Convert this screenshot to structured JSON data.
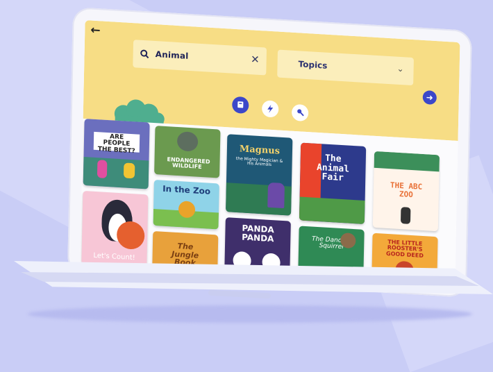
{
  "header": {
    "back_icon": "back-arrow-icon",
    "search": {
      "value": "Animal",
      "icon": "search-icon",
      "clear_icon": "close-icon"
    },
    "topics": {
      "label": "Topics",
      "icon": "chevron-down-icon"
    },
    "go_icon": "arrow-right-icon",
    "filters": [
      {
        "icon": "book-icon",
        "active": true
      },
      {
        "icon": "lightning-icon",
        "active": false
      },
      {
        "icon": "microphone-icon",
        "active": false
      }
    ]
  },
  "books": [
    {
      "title": "ARE PEOPLE THE BEST?"
    },
    {
      "title": "ENDANGERED WILDLIFE"
    },
    {
      "title": "Magnus",
      "subtitle": "the Mighty Magician & His Animals"
    },
    {
      "title": "The Animal Fair"
    },
    {
      "title": "THE ABC ZOO"
    },
    {
      "title": "Let's Count!"
    },
    {
      "title": "In the Zoo"
    },
    {
      "title": "PANDA PANDA"
    },
    {
      "title": "The Jungle Book"
    },
    {
      "title": "The Dancing Squirrel"
    },
    {
      "title": "THE LITTLE ROOSTER'S GOOD DEED"
    }
  ],
  "colors": {
    "header": "#f7dd85",
    "accent": "#3c47c9",
    "background": "#c9cdf6"
  }
}
